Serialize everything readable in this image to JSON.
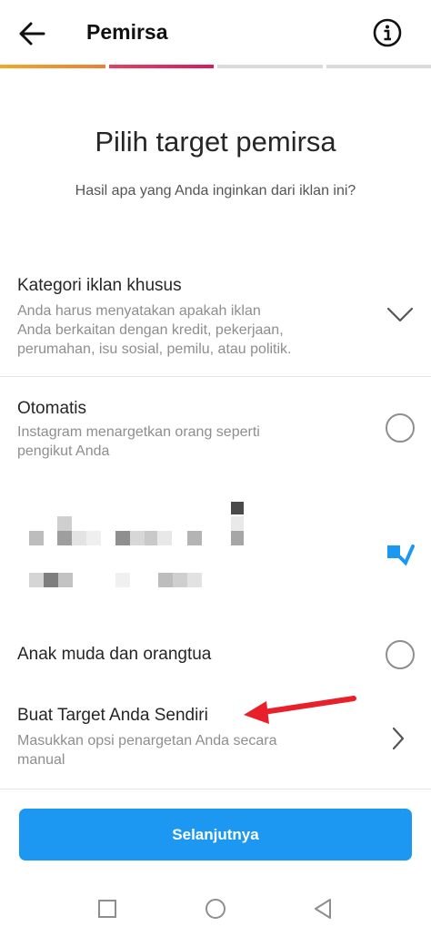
{
  "header": {
    "title": "Pemirsa"
  },
  "progress_step": 2,
  "progress_total": 4,
  "colors": {
    "accent": "#1c97f2",
    "progress_gradient": [
      "#f5a623",
      "#e4405f",
      "#d81b60"
    ],
    "annotation_arrow": "#e8202a"
  },
  "main": {
    "title": "Pilih target pemirsa",
    "subtitle": "Hasil apa yang Anda inginkan dari iklan ini?"
  },
  "options": {
    "special": {
      "title": "Kategori iklan khusus",
      "desc_lines": [
        "Anda harus menyatakan apakah iklan",
        "Anda berkaitan dengan kredit, pekerjaan,",
        "perumahan, isu sosial, pemilu, atau politik."
      ]
    },
    "automatic": {
      "title": "Otomatis",
      "desc_lines": [
        "Instagram menargetkan orang seperti",
        "pengikut Anda"
      ]
    },
    "young_parents": {
      "title": "Anak muda dan orangtua"
    },
    "custom": {
      "title": "Buat Target Anda Sendiri",
      "desc_lines": [
        "Masukkan opsi penargetan Anda secara",
        "manual"
      ]
    }
  },
  "buttons": {
    "next": "Selanjutnya"
  },
  "icons": {
    "back": "arrow-left-icon",
    "info": "info-icon",
    "expand": "chevron-down-icon",
    "open": "chevron-right-icon",
    "nav_recents": "square-icon",
    "nav_home": "circle-icon",
    "nav_back": "triangle-back-icon"
  }
}
